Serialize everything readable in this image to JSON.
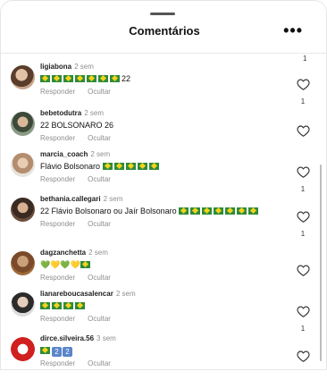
{
  "header": {
    "title": "Comentários",
    "more": "•••"
  },
  "actions": {
    "reply": "Responder",
    "hide": "Ocultar"
  },
  "top_count": "1",
  "comments": [
    {
      "username": "ligiabona",
      "time": "2 sem",
      "text": "22",
      "flags_before": 7,
      "likes": "1"
    },
    {
      "username": "bebetodutra",
      "time": "2 sem",
      "text": "22  BOLSONARO 26",
      "likes": ""
    },
    {
      "username": "marcia_coach",
      "time": "2 sem",
      "text": "Flávio Bolsonaro",
      "flags_after": 5,
      "likes": "1"
    },
    {
      "username": "bethania.callegari",
      "time": "2 sem",
      "text": "22 Flávio Bolsonaro ou Jaír Bolsonaro",
      "flags_after": 7,
      "likes": "1"
    },
    {
      "username": "dagzanchetta",
      "time": "2 sem",
      "text": "",
      "emoji": "💚💛💚💛",
      "likes": ""
    },
    {
      "username": "lianareboucasalencar",
      "time": "2 sem",
      "text": "",
      "flags_before": 4,
      "likes": "1"
    },
    {
      "username": "dirce.silveira.56",
      "time": "3 sem",
      "text": "",
      "boxes": [
        "2",
        "2"
      ],
      "likes": ""
    }
  ],
  "colors": {
    "flag_green": "#2e8b3a",
    "flag_yellow": "#f3d21b",
    "muted": "#8e8e8e"
  }
}
